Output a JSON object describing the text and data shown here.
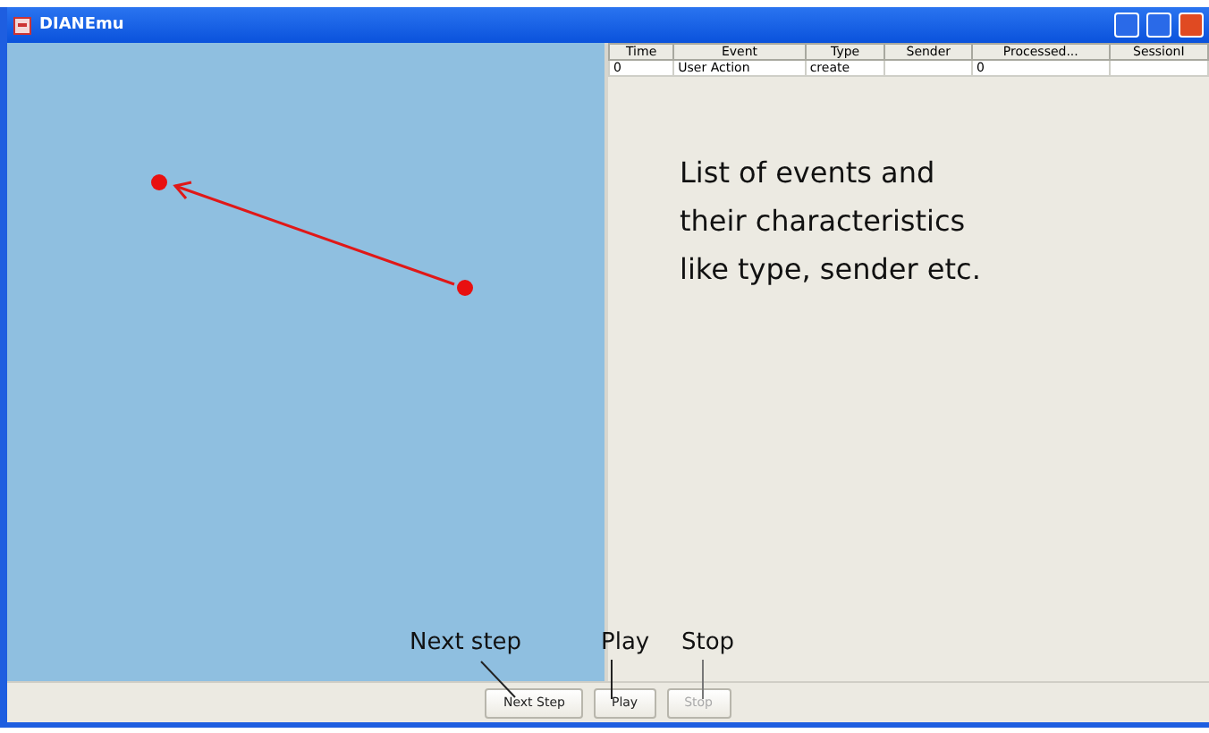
{
  "window": {
    "title": "DIANEmu"
  },
  "table": {
    "columns": [
      "Time",
      "Event",
      "Type",
      "Sender",
      "Processed...",
      "SessionI"
    ],
    "rows": [
      [
        "0",
        "User Action",
        "create",
        "",
        "0",
        ""
      ]
    ]
  },
  "note": [
    "List of events and",
    "their characteristics",
    "like type, sender etc."
  ],
  "buttons": [
    {
      "label": "Next Step",
      "disabled": false
    },
    {
      "label": "Play",
      "disabled": false
    },
    {
      "label": "Stop",
      "disabled": true
    }
  ],
  "callouts": [
    "Next step",
    "Play",
    "Stop"
  ]
}
